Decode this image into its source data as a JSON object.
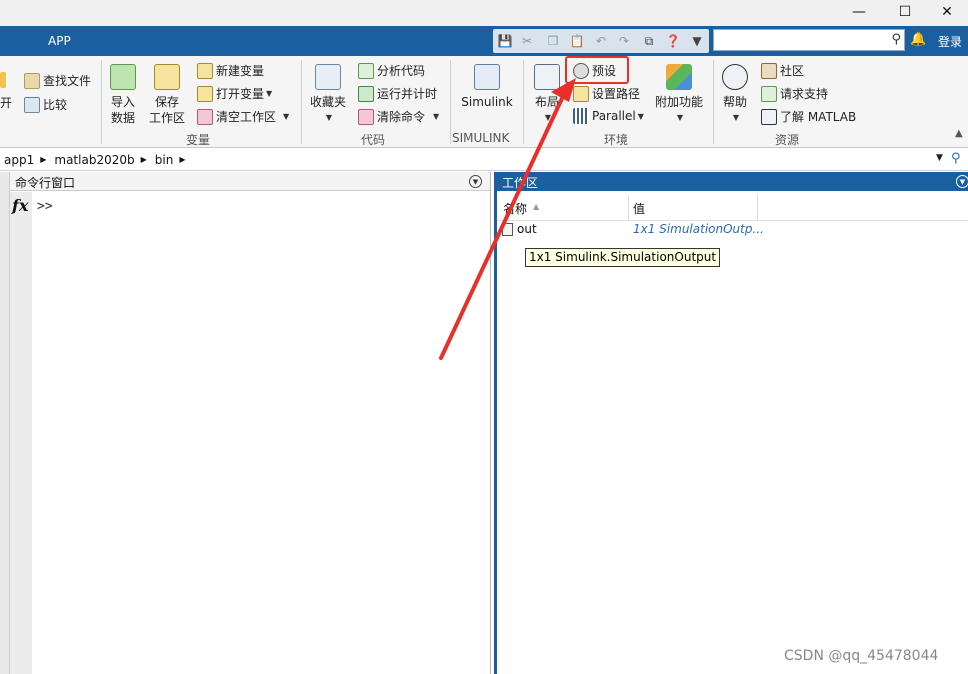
{
  "app": {
    "tab": "APP"
  },
  "toolbar_right": {
    "login": "登录"
  },
  "ribbon": {
    "file": {
      "open": "开",
      "find_files": "查找文件",
      "compare": "比较"
    },
    "variable": {
      "import_line1": "导入",
      "import_line2": "数据",
      "save_line1": "保存",
      "save_line2": "工作区",
      "new_var": "新建变量",
      "open_var": "打开变量",
      "clear_ws": "清空工作区",
      "section": "变量"
    },
    "code": {
      "favorites": "收藏夹",
      "analyze": "分析代码",
      "run_time": "运行并计时",
      "clear_cmd": "清除命令",
      "section": "代码"
    },
    "simulink": {
      "label": "Simulink",
      "section": "SIMULINK"
    },
    "env": {
      "layout": "布局",
      "preferences": "预设",
      "set_path": "设置路径",
      "parallel": "Parallel",
      "addons": "附加功能",
      "section": "环境"
    },
    "resources": {
      "help": "帮助",
      "community": "社区",
      "support": "请求支持",
      "learn": "了解 MATLAB",
      "section": "资源"
    }
  },
  "address": {
    "crumbs": [
      "app1",
      "matlab2020b",
      "bin"
    ]
  },
  "command_window": {
    "title": "命令行窗口",
    "prompt": ">>",
    "fx": "fx"
  },
  "workspace": {
    "title": "工作区",
    "col_name": "名称",
    "col_value": "值",
    "rows": [
      {
        "name": "out",
        "value": "1x1 SimulationOutp..."
      }
    ],
    "tooltip": "1x1 Simulink.SimulationOutput"
  },
  "watermark": "CSDN @qq_45478044",
  "colors": {
    "app_blue": "#1a5fa0",
    "highlight_red": "#e8302a"
  }
}
